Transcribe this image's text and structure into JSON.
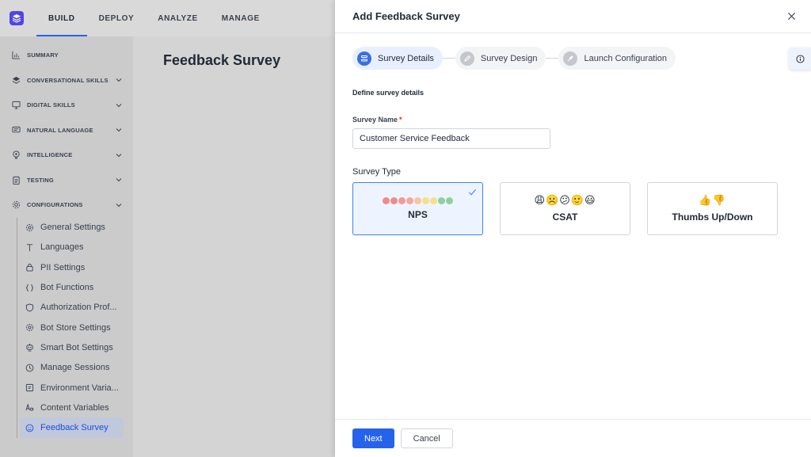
{
  "topnav": {
    "items": [
      {
        "label": "BUILD",
        "active": true
      },
      {
        "label": "DEPLOY"
      },
      {
        "label": "ANALYZE"
      },
      {
        "label": "MANAGE"
      }
    ]
  },
  "sidebar": {
    "items": [
      {
        "label": "SUMMARY",
        "icon": "bar-chart-icon"
      },
      {
        "label": "CONVERSATIONAL SKILLS",
        "icon": "layers-icon"
      },
      {
        "label": "DIGITAL SKILLS",
        "icon": "monitor-icon"
      },
      {
        "label": "NATURAL LANGUAGE",
        "icon": "chat-icon"
      },
      {
        "label": "INTELLIGENCE",
        "icon": "brain-icon"
      },
      {
        "label": "TESTING",
        "icon": "clipboard-icon"
      },
      {
        "label": "CONFIGURATIONS",
        "icon": "config-icon"
      }
    ],
    "sub_items": [
      {
        "label": "General Settings",
        "icon": "gear-icon"
      },
      {
        "label": "Languages",
        "icon": "text-icon"
      },
      {
        "label": "PII Settings",
        "icon": "lock-icon"
      },
      {
        "label": "Bot Functions",
        "icon": "braces-icon"
      },
      {
        "label": "Authorization Prof...",
        "icon": "shield-icon"
      },
      {
        "label": "Bot Store Settings",
        "icon": "gear-icon"
      },
      {
        "label": "Smart Bot Settings",
        "icon": "bot-icon"
      },
      {
        "label": "Manage Sessions",
        "icon": "clock-icon"
      },
      {
        "label": "Environment Varia...",
        "icon": "variable-icon"
      },
      {
        "label": "Content Variables",
        "icon": "aa-icon"
      },
      {
        "label": "Feedback Survey",
        "icon": "smile-icon",
        "active": true
      }
    ]
  },
  "main": {
    "title": "Feedback Survey"
  },
  "panel": {
    "title": "Add Feedback Survey",
    "steps": [
      {
        "label": "Survey Details",
        "active": true
      },
      {
        "label": "Survey Design"
      },
      {
        "label": "Launch Configuration"
      }
    ],
    "section_label": "Define survey details",
    "survey_name": {
      "label": "Survey Name",
      "required_mark": "*",
      "value": "Customer Service Feedback"
    },
    "survey_type": {
      "label": "Survey Type",
      "options": [
        {
          "name": "NPS",
          "selected": true
        },
        {
          "name": "CSAT",
          "emoji": "😩☹️😕🙂😃"
        },
        {
          "name": "Thumbs Up/Down",
          "emoji": "👍👎"
        }
      ],
      "nps_colors": [
        "#f08a8a",
        "#f08a8a",
        "#f29a9a",
        "#f5a7a0",
        "#f5c6a0",
        "#f2e08a",
        "#f2e08a",
        "#8fd19e",
        "#8fd19e"
      ]
    },
    "footer": {
      "next_label": "Next",
      "cancel_label": "Cancel"
    }
  },
  "colors": {
    "accent": "#2563eb",
    "logo": "#4f46e5"
  }
}
